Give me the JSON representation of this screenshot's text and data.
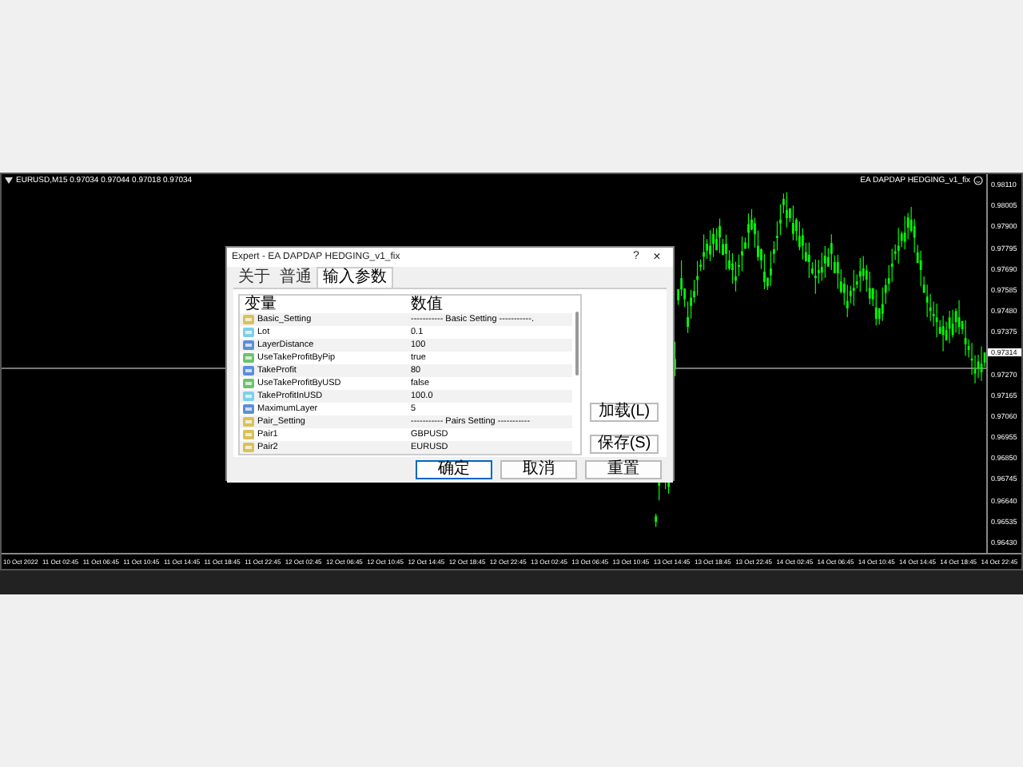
{
  "chart": {
    "symbol_info": "EURUSD,M15  0.97034 0.97044 0.97018 0.97034",
    "expert_label": "EA DAPDAP HEDGING_v1_fix",
    "price_axis": [
      {
        "kind": "tick",
        "label": "0.98110"
      },
      {
        "kind": "tick",
        "label": "0.98005"
      },
      {
        "kind": "tick",
        "label": "0.97900"
      },
      {
        "kind": "tick",
        "label": "0.97795"
      },
      {
        "kind": "tick",
        "label": "0.97690"
      },
      {
        "kind": "tick",
        "label": "0.97585"
      },
      {
        "kind": "tick",
        "label": "0.97480"
      },
      {
        "kind": "tick",
        "label": "0.97375"
      },
      {
        "kind": "current",
        "label": "0.97314"
      },
      {
        "kind": "tick",
        "label": "0.97270"
      },
      {
        "kind": "tick",
        "label": "0.97165"
      },
      {
        "kind": "tick",
        "label": "0.97060"
      },
      {
        "kind": "tick",
        "label": "0.96955"
      },
      {
        "kind": "tick",
        "label": "0.96850"
      },
      {
        "kind": "tick",
        "label": "0.96745"
      },
      {
        "kind": "tick",
        "label": "0.96640"
      },
      {
        "kind": "tick",
        "label": "0.96535"
      },
      {
        "kind": "tick",
        "label": "0.96430"
      }
    ],
    "time_axis": [
      "10 Oct 2022",
      "11 Oct 02:45",
      "11 Oct 06:45",
      "11 Oct 10:45",
      "11 Oct 14:45",
      "11 Oct 18:45",
      "11 Oct 22:45",
      "12 Oct 02:45",
      "12 Oct 06:45",
      "12 Oct 10:45",
      "12 Oct 14:45",
      "12 Oct 18:45",
      "12 Oct 22:45",
      "13 Oct 02:45",
      "13 Oct 06:45",
      "13 Oct 10:45",
      "13 Oct 14:45",
      "13 Oct 18:45",
      "13 Oct 22:45",
      "14 Oct 02:45",
      "14 Oct 06:45",
      "14 Oct 10:45",
      "14 Oct 14:45",
      "14 Oct 18:45",
      "14 Oct 22:45"
    ]
  },
  "dialog": {
    "title": "Expert - EA DAPDAP HEDGING_v1_fix",
    "help": "?",
    "close": "×",
    "tabs": [
      {
        "label": "关于",
        "selected": false
      },
      {
        "label": "普通",
        "selected": false
      },
      {
        "label": "输入参数",
        "selected": true
      }
    ],
    "columns": [
      "变量",
      "数值"
    ],
    "rows": [
      {
        "kind": "string",
        "name": "Basic_Setting",
        "value": "----------- Basic Setting -----------."
      },
      {
        "kind": "double",
        "name": "Lot",
        "value": "0.1"
      },
      {
        "kind": "int",
        "name": "LayerDistance",
        "value": "100"
      },
      {
        "kind": "bool",
        "name": "UseTakeProfitByPip",
        "value": "true"
      },
      {
        "kind": "int",
        "name": "TakeProfit",
        "value": "80"
      },
      {
        "kind": "bool",
        "name": "UseTakeProfitByUSD",
        "value": "false"
      },
      {
        "kind": "double",
        "name": "TakeProfitInUSD",
        "value": "100.0"
      },
      {
        "kind": "int",
        "name": "MaximumLayer",
        "value": "5"
      },
      {
        "kind": "string",
        "name": "Pair_Setting",
        "value": "----------- Pairs Setting -----------"
      },
      {
        "kind": "string",
        "name": "Pair1",
        "value": "GBPUSD"
      },
      {
        "kind": "string",
        "name": "Pair2",
        "value": "EURUSD"
      }
    ],
    "side_buttons": [
      "加载(L)",
      "保存(S)"
    ],
    "bottom_buttons": [
      {
        "label": "确定",
        "selected": true
      },
      {
        "label": "取消",
        "selected": false
      },
      {
        "label": "重置",
        "selected": false
      }
    ]
  }
}
